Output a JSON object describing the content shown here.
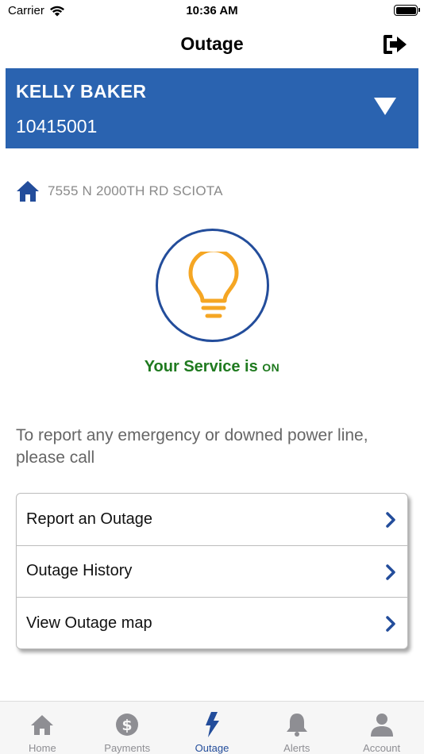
{
  "status_bar": {
    "carrier": "Carrier",
    "time": "10:36 AM"
  },
  "nav": {
    "title": "Outage",
    "logout_icon": "logout-icon"
  },
  "account": {
    "name": "KELLY BAKER",
    "number": "10415001",
    "dropdown_icon": "triangle-down-icon"
  },
  "address": {
    "icon": "home-icon",
    "text": "7555 N 2000TH RD SCIOTA"
  },
  "service": {
    "icon": "lightbulb-icon",
    "prefix": "Your Service is ",
    "state": "ON"
  },
  "emergency": {
    "text": "To report any emergency or downed power line, please call"
  },
  "options": [
    {
      "label": "Report an Outage"
    },
    {
      "label": "Outage History"
    },
    {
      "label": "View Outage map"
    }
  ],
  "tabs": [
    {
      "label": "Home",
      "icon": "home-icon"
    },
    {
      "label": "Payments",
      "icon": "dollar-icon"
    },
    {
      "label": "Outage",
      "icon": "lightning-icon",
      "active": true
    },
    {
      "label": "Alerts",
      "icon": "bell-icon"
    },
    {
      "label": "Account",
      "icon": "person-icon"
    }
  ],
  "colors": {
    "banner": "#2a63b0",
    "accent": "#234d9b",
    "bulb": "#f5a623",
    "service_on": "#1f7a1f",
    "tab_inactive": "#8e8e93"
  }
}
